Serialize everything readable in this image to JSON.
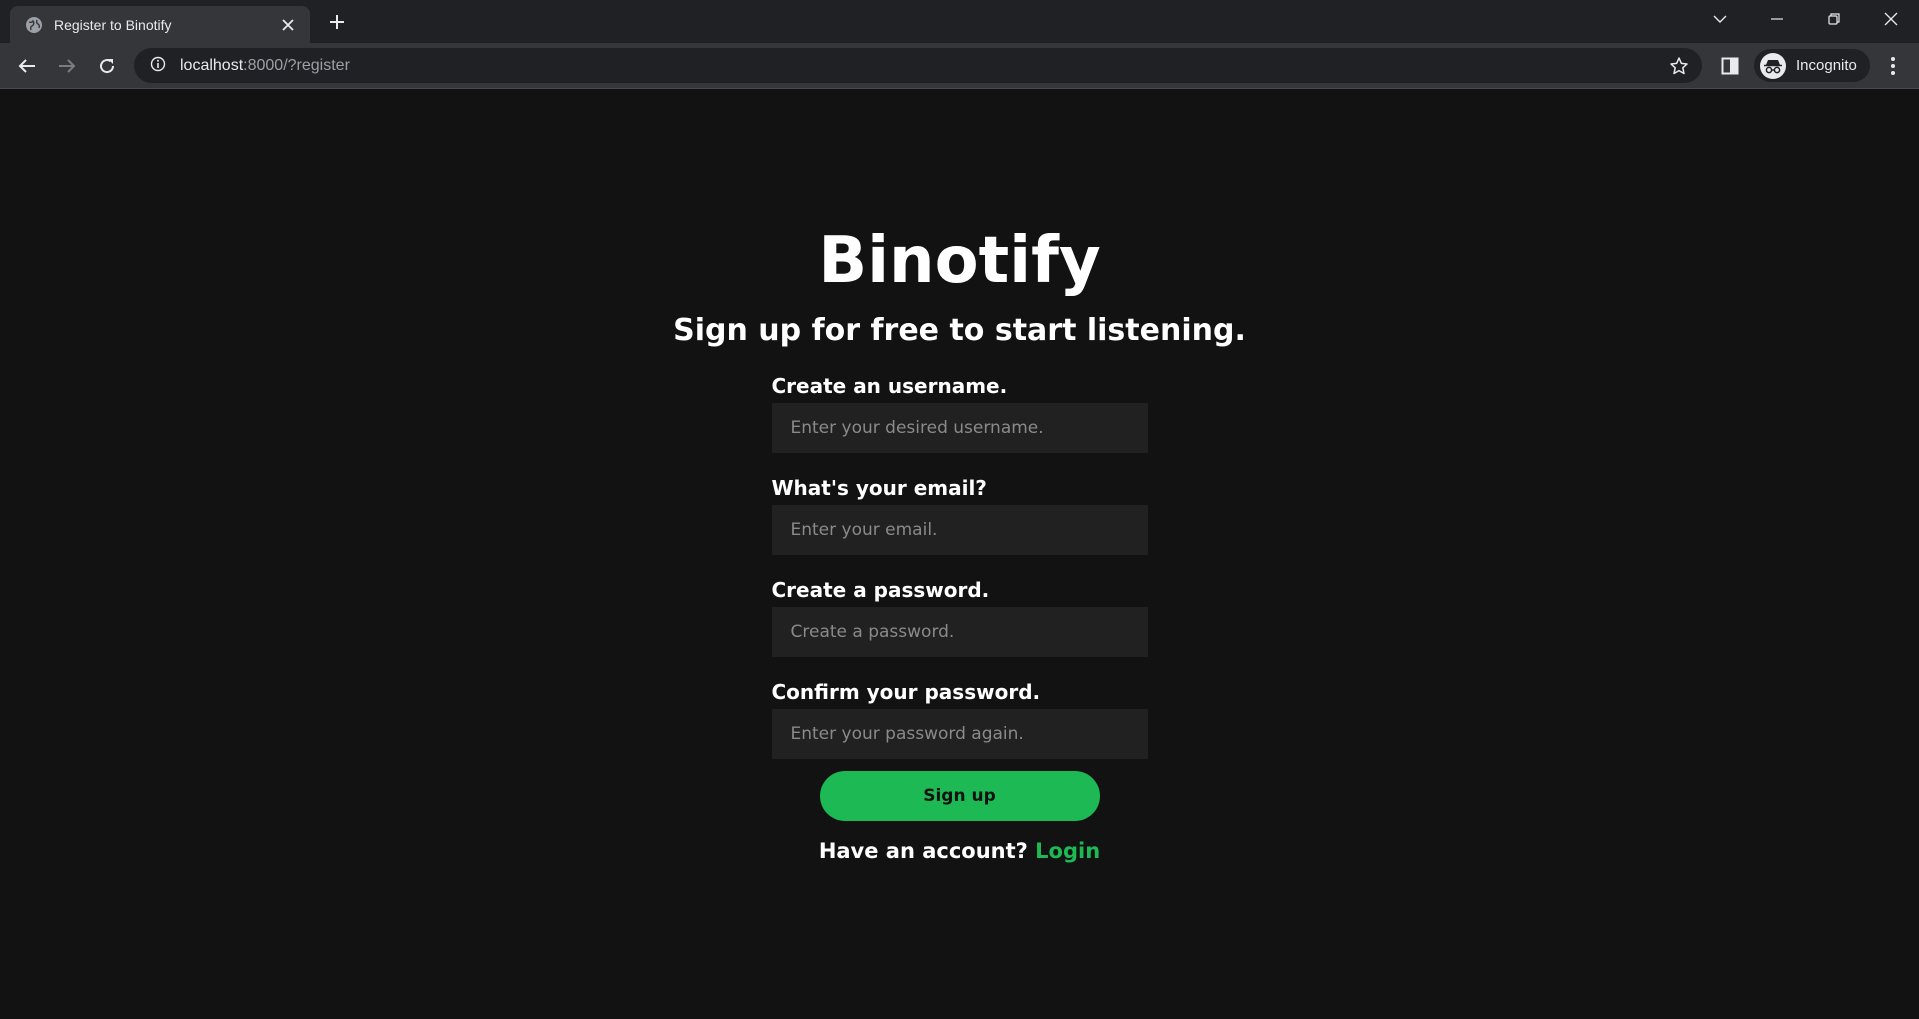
{
  "browser": {
    "tab_title": "Register to Binotify",
    "url_host": "localhost",
    "url_rest": ":8000/?register",
    "profile_label": "Incognito"
  },
  "page": {
    "brand": "Binotify",
    "subtitle": "Sign up for free to start listening.",
    "fields": [
      {
        "label": "Create an username.",
        "placeholder": "Enter your desired username."
      },
      {
        "label": "What's your email?",
        "placeholder": "Enter your email."
      },
      {
        "label": "Create a password.",
        "placeholder": "Create a password."
      },
      {
        "label": "Confirm your password.",
        "placeholder": "Enter your password again."
      }
    ],
    "signup_label": "Sign up",
    "have_account_text": "Have an account? ",
    "login_label": "Login"
  },
  "colors": {
    "accent": "#1db954",
    "background": "#121212",
    "input_bg": "#212121"
  }
}
